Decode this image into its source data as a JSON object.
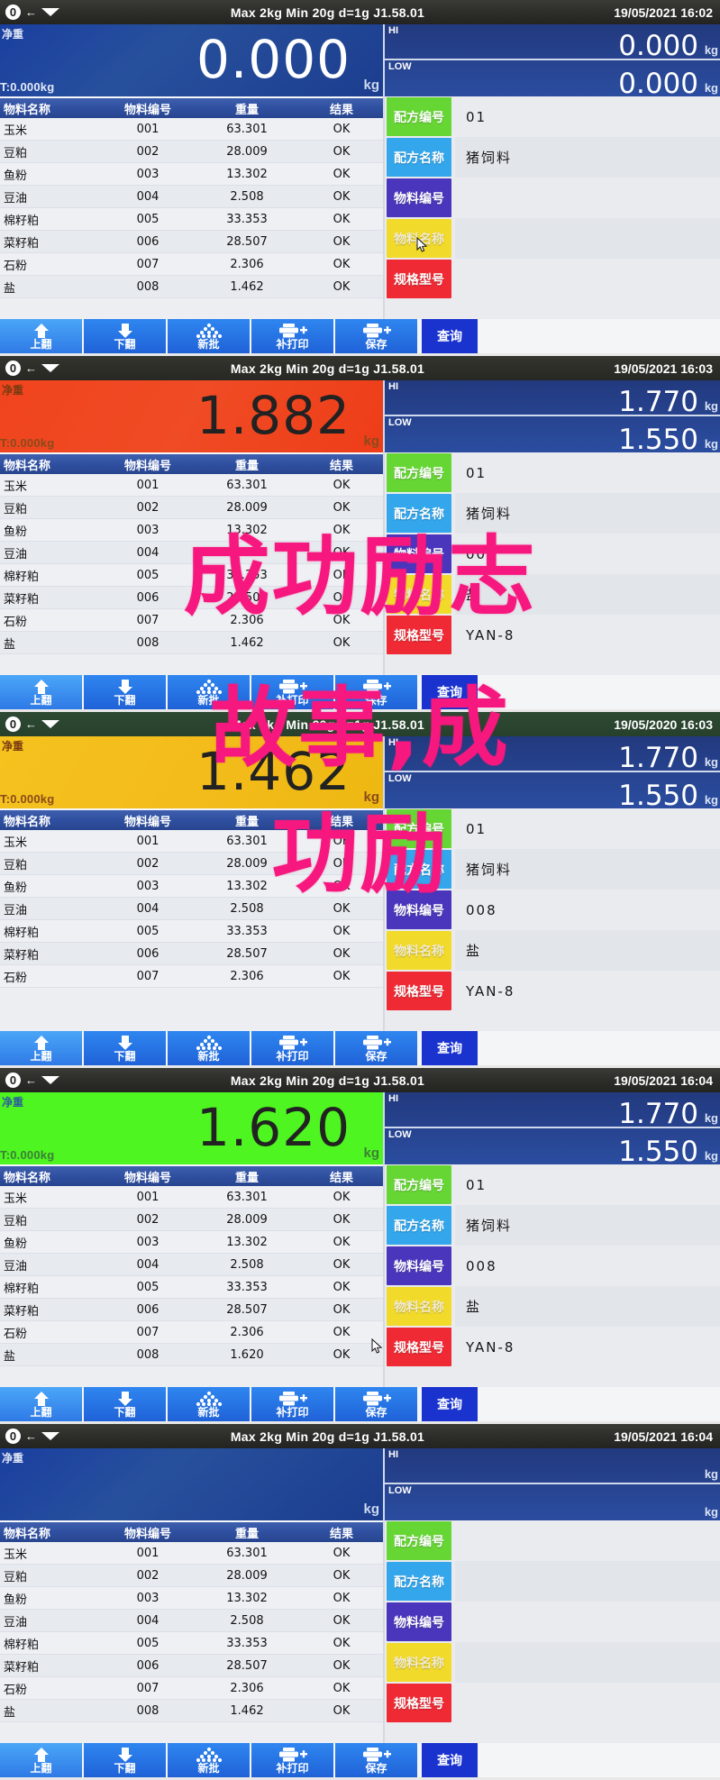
{
  "device": {
    "spec_line": "Max 2kg  Min 20g  d=1g    J1.58.01",
    "net_label": "净重",
    "unit": "kg",
    "hi_label": "HI",
    "low_label": "LOW",
    "status_icons": [
      "zero-icon",
      "arrow-left-icon",
      "stability-icon"
    ]
  },
  "table": {
    "headers": [
      "物料名称",
      "物料编号",
      "重量",
      "结果"
    ],
    "rows_full": [
      {
        "name": "玉米",
        "code": "001",
        "weight": "63.301",
        "result": "OK"
      },
      {
        "name": "豆粕",
        "code": "002",
        "weight": "28.009",
        "result": "OK"
      },
      {
        "name": "鱼粉",
        "code": "003",
        "weight": "13.302",
        "result": "OK"
      },
      {
        "name": "豆油",
        "code": "004",
        "weight": "2.508",
        "result": "OK"
      },
      {
        "name": "棉籽粕",
        "code": "005",
        "weight": "33.353",
        "result": "OK"
      },
      {
        "name": "菜籽粕",
        "code": "006",
        "weight": "28.507",
        "result": "OK"
      },
      {
        "name": "石粉",
        "code": "007",
        "weight": "2.306",
        "result": "OK"
      },
      {
        "name": "盐",
        "code": "008",
        "weight": "1.462",
        "result": "OK"
      }
    ],
    "rows_seven": [
      {
        "name": "玉米",
        "code": "001",
        "weight": "63.301",
        "result": "OK"
      },
      {
        "name": "豆粕",
        "code": "002",
        "weight": "28.009",
        "result": "OK"
      },
      {
        "name": "鱼粉",
        "code": "003",
        "weight": "13.302",
        "result": "OK"
      },
      {
        "name": "豆油",
        "code": "004",
        "weight": "2.508",
        "result": "OK"
      },
      {
        "name": "棉籽粕",
        "code": "005",
        "weight": "33.353",
        "result": "OK"
      },
      {
        "name": "菜籽粕",
        "code": "006",
        "weight": "28.507",
        "result": "OK"
      },
      {
        "name": "石粉",
        "code": "007",
        "weight": "2.306",
        "result": "OK"
      }
    ],
    "rows_last_620": [
      {
        "name": "玉米",
        "code": "001",
        "weight": "63.301",
        "result": "OK"
      },
      {
        "name": "豆粕",
        "code": "002",
        "weight": "28.009",
        "result": "OK"
      },
      {
        "name": "鱼粉",
        "code": "003",
        "weight": "13.302",
        "result": "OK"
      },
      {
        "name": "豆油",
        "code": "004",
        "weight": "2.508",
        "result": "OK"
      },
      {
        "name": "棉籽粕",
        "code": "005",
        "weight": "33.353",
        "result": "OK"
      },
      {
        "name": "菜籽粕",
        "code": "006",
        "weight": "28.507",
        "result": "OK"
      },
      {
        "name": "石粉",
        "code": "007",
        "weight": "2.306",
        "result": "OK"
      },
      {
        "name": "盐",
        "code": "008",
        "weight": "1.620",
        "result": "OK"
      }
    ]
  },
  "info_labels": {
    "recipe_code": "配方编号",
    "recipe_name": "配方名称",
    "material_code": "物料编号",
    "material_name": "物料名称",
    "spec_model": "规格型号"
  },
  "buttons": {
    "page_up": "上翻",
    "page_down": "下翻",
    "new_batch": "新批",
    "reprint": "补打印",
    "save": "保存",
    "query": "查询"
  },
  "colors": {
    "key_green": "#66d634",
    "key_blue": "#33a6ec",
    "key_violet": "#4a36bd",
    "key_yellow": "#f2da2a",
    "key_red": "#f02a34",
    "button_blue": "#1f62d8",
    "query_blue": "#1a33cf",
    "display_blue": "#27509c",
    "display_red": "#ef4b24",
    "display_yellow": "#f3bc1b",
    "display_green": "#4ef520",
    "watermark_pink": "#f6187f"
  },
  "panels": [
    {
      "id": "panel-1",
      "datetime": "19/05/2021  16:02",
      "weight": "0.000",
      "tare": "T:0.000kg",
      "display_color": "blue",
      "hi": "0.000",
      "low": "0.000",
      "info": {
        "recipe_code": "01",
        "recipe_name": "猪饲料",
        "material_code": "",
        "material_name": "",
        "spec_model": ""
      },
      "rows_key": "rows_full",
      "cursor_on": "material-name-key"
    },
    {
      "id": "panel-2",
      "datetime": "19/05/2021  16:03",
      "weight": "1.882",
      "tare": "T:0.000kg",
      "display_color": "red",
      "hi": "1.770",
      "low": "1.550",
      "info": {
        "recipe_code": "01",
        "recipe_name": "猪饲料",
        "material_code": "008",
        "material_name": "盐",
        "spec_model": "YAN-8"
      },
      "rows_key": "rows_full",
      "cursor_on": ""
    },
    {
      "id": "panel-3",
      "datetime": "19/05/2020  16:03",
      "weight": "1.462",
      "tare": "T:0.000kg",
      "display_color": "yellow",
      "hi": "1.770",
      "low": "1.550",
      "info": {
        "recipe_code": "01",
        "recipe_name": "猪饲料",
        "material_code": "008",
        "material_name": "盐",
        "spec_model": "YAN-8"
      },
      "rows_key": "rows_seven",
      "cursor_on": ""
    },
    {
      "id": "panel-4",
      "datetime": "19/05/2021  16:04",
      "weight": "1.620",
      "tare": "T:0.000kg",
      "display_color": "green",
      "hi": "1.770",
      "low": "1.550",
      "info": {
        "recipe_code": "01",
        "recipe_name": "猪饲料",
        "material_code": "008",
        "material_name": "盐",
        "spec_model": "YAN-8"
      },
      "rows_key": "rows_last_620",
      "cursor_on": "save-button"
    },
    {
      "id": "panel-5",
      "datetime": "19/05/2021  16:04",
      "weight": "",
      "tare": "",
      "display_color": "blue",
      "hi": "",
      "low": "",
      "info": {
        "recipe_code": "",
        "recipe_name": "",
        "material_code": "",
        "material_name": "",
        "spec_model": ""
      },
      "rows_key": "rows_full",
      "cursor_on": ""
    }
  ],
  "watermark": {
    "line1": "成功励志",
    "line2": "故事,成",
    "line3": "功励"
  }
}
